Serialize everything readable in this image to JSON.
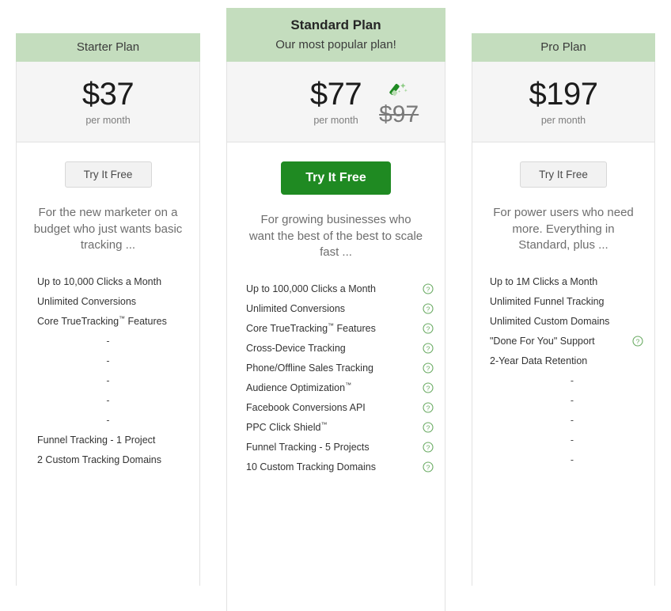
{
  "theme": {
    "header_green": "#c4ddbe",
    "cta_green": "#1f8a22",
    "help_icon_green": "#6aab63",
    "price_panel_bg": "#f5f5f5",
    "border": "#e2e2e2"
  },
  "plans": [
    {
      "id": "starter",
      "title": "Starter Plan",
      "subtitle": "",
      "price": "$37",
      "period": "per month",
      "old_price": "",
      "cta_label": "Try It Free",
      "cta_style": "plain",
      "description": "For the new marketer on a budget who just wants basic tracking ...",
      "features": [
        {
          "label": "Up to 10,000 Clicks a Month",
          "help": false,
          "blank": false
        },
        {
          "label": "Unlimited Conversions",
          "help": false,
          "blank": false
        },
        {
          "label": "Core TrueTracking™ Features",
          "help": false,
          "blank": false
        },
        {
          "label": "-",
          "help": false,
          "blank": true
        },
        {
          "label": "-",
          "help": false,
          "blank": true
        },
        {
          "label": "-",
          "help": false,
          "blank": true
        },
        {
          "label": "-",
          "help": false,
          "blank": true
        },
        {
          "label": "-",
          "help": false,
          "blank": true
        },
        {
          "label": "Funnel Tracking - 1 Project",
          "help": false,
          "blank": false
        },
        {
          "label": "2 Custom Tracking Domains",
          "help": false,
          "blank": false
        }
      ]
    },
    {
      "id": "standard",
      "title": "Standard Plan",
      "subtitle": "Our most popular plan!",
      "price": "$77",
      "period": "per month",
      "old_price": "$97",
      "cta_label": "Try It Free",
      "cta_style": "primary",
      "description": "For growing businesses who want the best of the best to scale fast ...",
      "features": [
        {
          "label": "Up to 100,000 Clicks a Month",
          "help": true,
          "blank": false
        },
        {
          "label": "Unlimited Conversions",
          "help": true,
          "blank": false
        },
        {
          "label": "Core TrueTracking™ Features",
          "help": true,
          "blank": false
        },
        {
          "label": "Cross-Device Tracking",
          "help": true,
          "blank": false
        },
        {
          "label": "Phone/Offline Sales Tracking",
          "help": true,
          "blank": false
        },
        {
          "label": "Audience Optimization™",
          "help": true,
          "blank": false
        },
        {
          "label": "Facebook Conversions API",
          "help": true,
          "blank": false
        },
        {
          "label": "PPC Click Shield™",
          "help": true,
          "blank": false
        },
        {
          "label": "Funnel Tracking - 5 Projects",
          "help": true,
          "blank": false
        },
        {
          "label": "10 Custom Tracking Domains",
          "help": true,
          "blank": false
        }
      ]
    },
    {
      "id": "pro",
      "title": "Pro Plan",
      "subtitle": "",
      "price": "$197",
      "period": "per month",
      "old_price": "",
      "cta_label": "Try It Free",
      "cta_style": "plain",
      "description": "For power users who need more. Everything in Standard, plus ...",
      "features": [
        {
          "label": "Up to 1M Clicks a Month",
          "help": false,
          "blank": false
        },
        {
          "label": "Unlimited Funnel Tracking",
          "help": false,
          "blank": false
        },
        {
          "label": "Unlimited Custom Domains",
          "help": false,
          "blank": false
        },
        {
          "label": "\"Done For You\" Support",
          "help": true,
          "blank": false
        },
        {
          "label": "2-Year Data Retention",
          "help": false,
          "blank": false
        },
        {
          "label": "-",
          "help": false,
          "blank": true
        },
        {
          "label": "-",
          "help": false,
          "blank": true
        },
        {
          "label": "-",
          "help": false,
          "blank": true
        },
        {
          "label": "-",
          "help": false,
          "blank": true
        },
        {
          "label": "-",
          "help": false,
          "blank": true
        }
      ]
    }
  ],
  "icons": {
    "help": "help-circle-icon",
    "discount": "magic-wand-icon"
  }
}
